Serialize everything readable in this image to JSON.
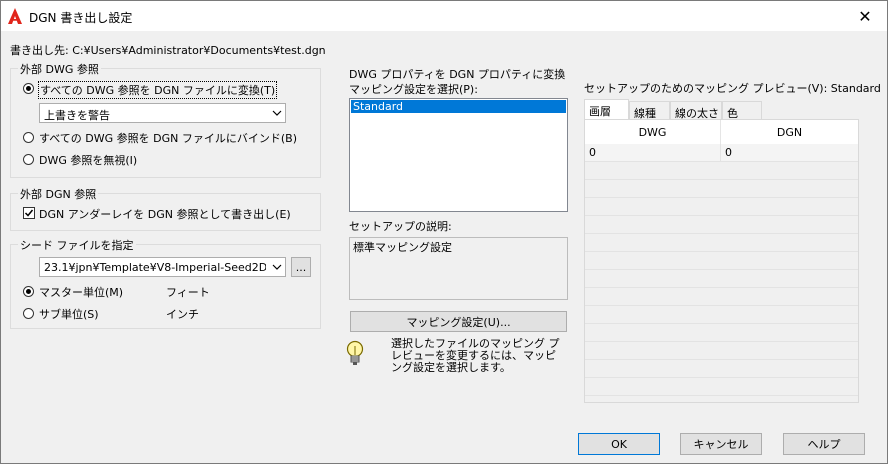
{
  "window": {
    "title": "DGN 書き出し設定"
  },
  "export_dest": "書き出し先: C:¥Users¥Administrator¥Documents¥test.dgn",
  "external_dwg": {
    "title": "外部 DWG 参照",
    "option_convert": "すべての DWG 参照を DGN ファイルに変換(T)",
    "overwrite_combo": "上書きを警告",
    "option_bind": "すべての DWG 参照を DGN ファイルにバインド(B)",
    "option_ignore": "DWG 参照を無視(I)"
  },
  "external_dgn": {
    "title": "外部 DGN 参照",
    "underlay_check": "DGN アンダーレイを DGN 参照として書き出し(E)"
  },
  "seed": {
    "title": "シード ファイルを指定",
    "file_combo": "23.1¥jpn¥Template¥V8-Imperial-Seed2D.dgn",
    "browse": "...",
    "master_unit": "マスター単位(M)",
    "master_value": "フィート",
    "sub_unit": "サブ単位(S)",
    "sub_value": "インチ"
  },
  "mapping": {
    "group_title": "DWG プロパティを DGN プロパティに変換",
    "select_label": "マッピング設定を選択(P):",
    "list_items": [
      "Standard"
    ],
    "desc_label": "セットアップの説明:",
    "desc_text": "標準マッピング設定",
    "setup_button": "マッピング設定(U)...",
    "hint": "選択したファイルのマッピング プレビューを変更するには、マッピング設定を選択します。"
  },
  "preview": {
    "label": "セットアップのためのマッピング プレビュー(V): Standard",
    "tabs": [
      "画層",
      "線種",
      "線の太さ",
      "色"
    ],
    "columns": [
      "DWG",
      "DGN"
    ],
    "rows": [
      [
        "0",
        "0"
      ]
    ]
  },
  "buttons": {
    "ok": "OK",
    "cancel": "キャンセル",
    "help": "ヘルプ"
  },
  "colors": {
    "accent": "#0078d7",
    "brand": "#e1251b"
  }
}
